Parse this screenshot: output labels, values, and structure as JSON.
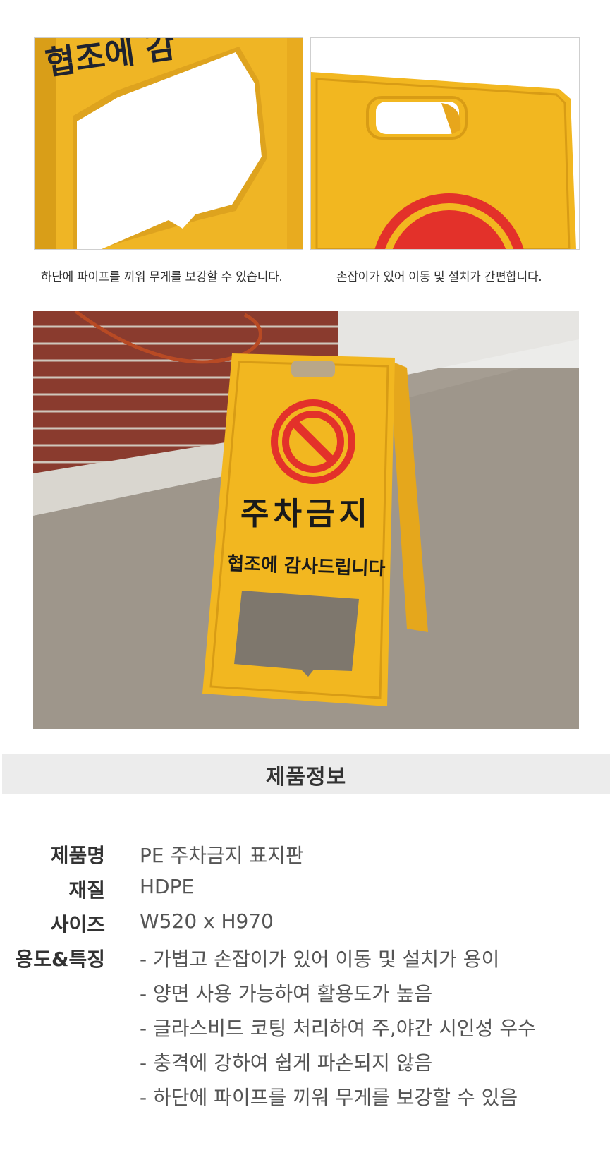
{
  "captions": {
    "left": "하단에 파이프를 끼워 무게를 보강할 수 있습니다.",
    "right": "손잡이가 있어 이동 및 설치가 간편합니다."
  },
  "photos": {
    "top_left": {
      "sign_text": "협조에 감"
    },
    "main": {
      "sign_title": "주차금지",
      "sign_subtitle": "협조에 감사드립니다"
    }
  },
  "colors": {
    "sign_yellow": "#f2b720",
    "prohibit_red": "#e3312a",
    "bar_gray": "#ececec"
  },
  "section": {
    "title": "제품정보"
  },
  "product_info": {
    "name_label": "제품명",
    "name_value": "PE 주차금지 표지판",
    "material_label": "재질",
    "material_value": "HDPE",
    "size_label": "사이즈",
    "size_value": "W520 x H970",
    "features_label": "용도&특징",
    "features": [
      "- 가볍고 손잡이가 있어 이동 및 설치가 용이",
      "- 양면 사용 가능하여 활용도가 높음",
      "- 글라스비드 코팅 처리하여 주,야간 시인성 우수",
      "- 충격에 강하여 쉽게 파손되지 않음",
      "- 하단에 파이프를 끼워 무게를 보강할 수 있음"
    ]
  }
}
